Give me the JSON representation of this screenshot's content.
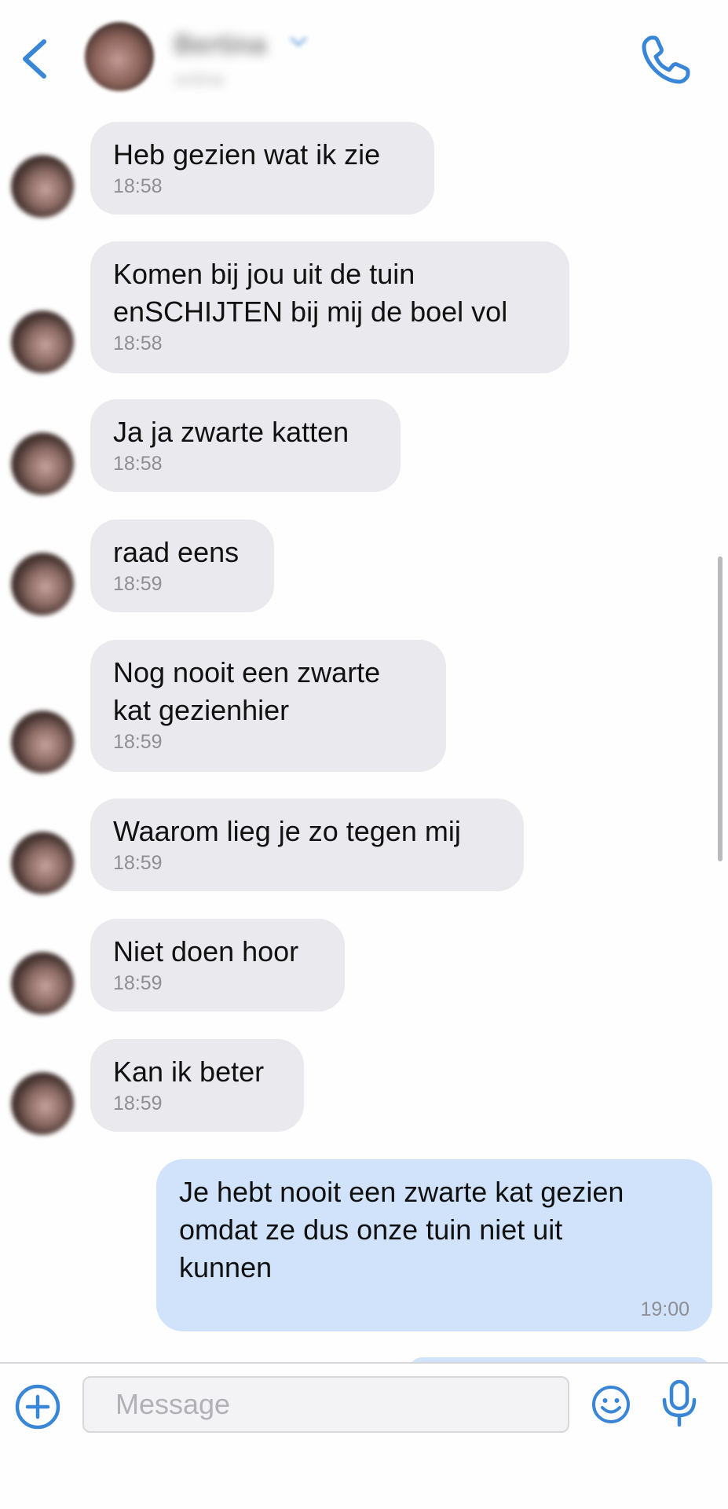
{
  "header": {
    "contact_name": "Bertina",
    "contact_status": "online"
  },
  "messages": [
    {
      "direction": "in",
      "text": "Heb gezien wat ik zie",
      "time": "18:58"
    },
    {
      "direction": "in",
      "text": "Komen bij jou uit de tuin\nenSCHIJTEN bij mij de boel vol",
      "time": "18:58"
    },
    {
      "direction": "in",
      "text": "Ja ja zwarte katten",
      "time": "18:58"
    },
    {
      "direction": "in",
      "text": "raad eens",
      "time": "18:59"
    },
    {
      "direction": "in",
      "text": "Nog nooit een zwarte\nkat gezienhier",
      "time": "18:59"
    },
    {
      "direction": "in",
      "text": "Waarom lieg je zo tegen mij",
      "time": "18:59"
    },
    {
      "direction": "in",
      "text": "Niet doen hoor",
      "time": "18:59"
    },
    {
      "direction": "in",
      "text": "Kan ik beter",
      "time": "18:59"
    },
    {
      "direction": "out",
      "text": "Je hebt nooit een zwarte kat gezien\nomdat ze dus onze tuin niet uit\nkunnen",
      "time": "19:00"
    }
  ],
  "composer": {
    "placeholder": "Message"
  },
  "colors": {
    "accent": "#3a86d6",
    "incoming_bubble": "#e9e9ee",
    "outgoing_bubble": "#d0e3fb"
  },
  "icons": {
    "back": "chevron-left-icon",
    "call": "phone-icon",
    "add": "plus-circle-icon",
    "emoji": "smiley-icon",
    "mic": "microphone-icon"
  }
}
